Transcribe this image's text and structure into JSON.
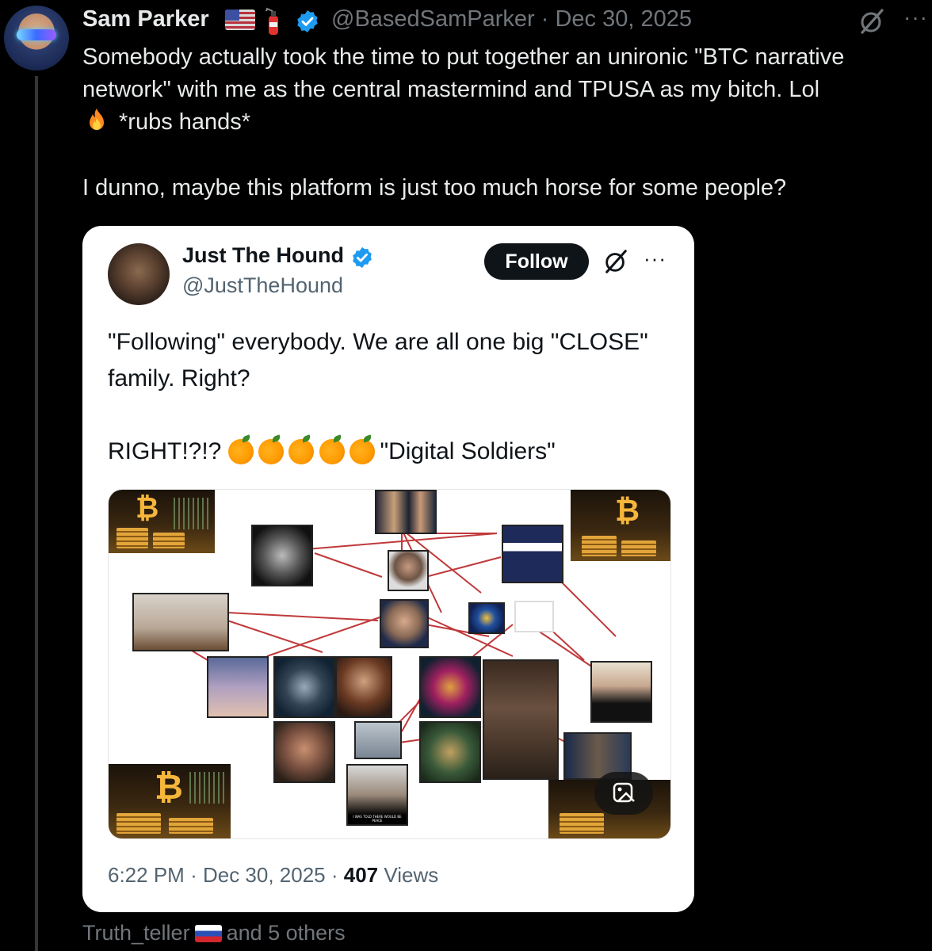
{
  "post": {
    "display_name": "Sam Parker",
    "handle": "@BasedSamParker",
    "date": "Dec 30, 2025",
    "handle_date": "@BasedSamParker · Dec 30, 2025",
    "text_line1": "Somebody actually took the time to put together an unironic \"BTC narrative network\" with me as the central mastermind and TPUSA as my bitch. Lol",
    "text_line2": "*rubs hands*",
    "text_line3": "I dunno, maybe this platform is just too much horse for some people?",
    "more_label": "···"
  },
  "quote": {
    "display_name": "Just The Hound",
    "handle": "@JustTheHound",
    "follow_label": "Follow",
    "more_label": "···",
    "text_line1": "\"Following\" everybody. We are all one big \"CLOSE\" family. Right?",
    "text_line2_prefix": "RIGHT!?!?",
    "text_line2_suffix": "\"Digital Soldiers\"",
    "time": "6:22 PM",
    "date": "Dec 30, 2025",
    "views_count": "407",
    "views_label": "Views",
    "image_caption": "I WAS TOLD THERE WOULD BE PEACE"
  },
  "reply_context": {
    "user": "Truth_teller",
    "others": "and 5 others"
  },
  "icons": {
    "verified": "verified-badge-icon",
    "grok": "grok-icon",
    "fire": "fire-icon",
    "orange": "tangerine-emoji",
    "edit_image": "edit-image-icon"
  },
  "colors": {
    "background": "#000000",
    "card": "#ffffff",
    "verified": "#1d9bf0",
    "muted": "#71767b",
    "network_lines": "#c0393b"
  }
}
